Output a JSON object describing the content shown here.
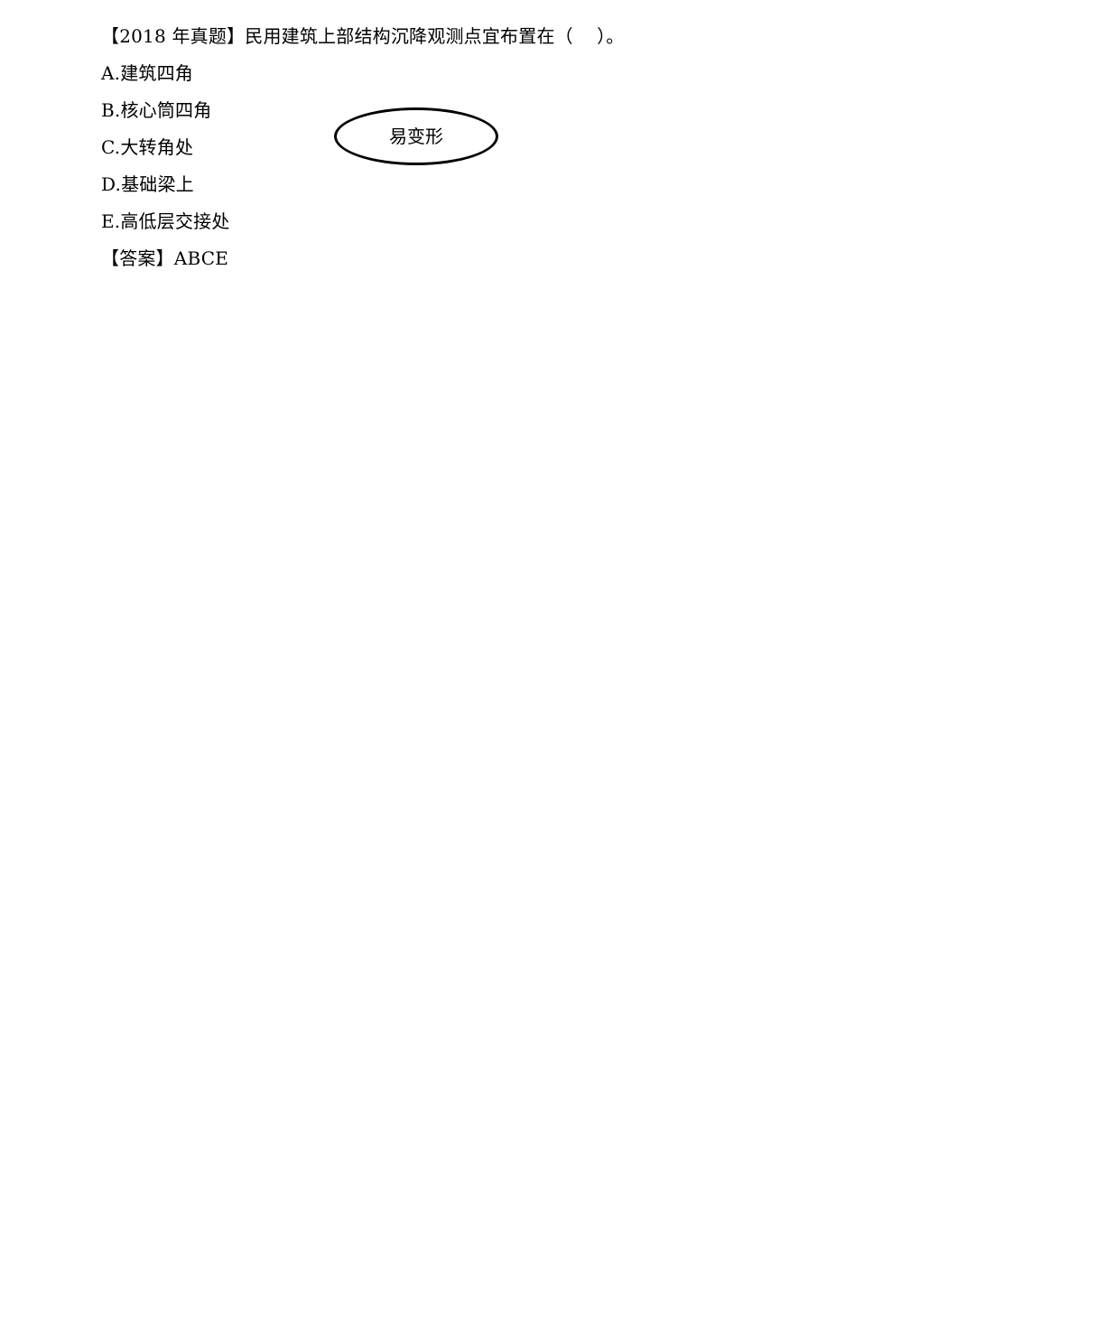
{
  "question": {
    "title": "【2018 年真题】民用建筑上部结构沉降观测点宜布置在（    ）。",
    "options": [
      "A.建筑四角",
      "B.核心筒四角",
      "C.大转角处",
      "D.基础梁上",
      "E.高低层交接处"
    ],
    "answer": "【答案】ABCE"
  },
  "annotation": {
    "text": "易变形"
  }
}
